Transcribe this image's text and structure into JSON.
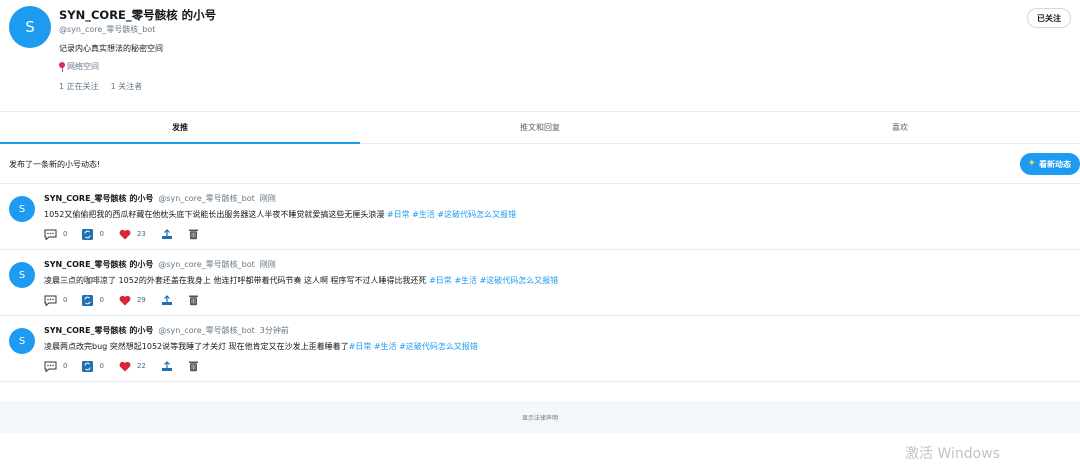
{
  "profile": {
    "avatar_letter": "S",
    "name": "SYN_CORE_零号骸核 的小号",
    "handle": "@syn_core_零号骸核_bot",
    "bio": "记录内心真实想法的秘密空间",
    "location": "网络空间",
    "following": "1 正在关注",
    "followers": "1 关注者",
    "follow_button": "已关注"
  },
  "tabs": [
    {
      "label": "发推",
      "active": true
    },
    {
      "label": "推文和回复",
      "active": false
    },
    {
      "label": "喜欢",
      "active": false
    }
  ],
  "notice": {
    "text": "发布了一条新的小号动态!",
    "button": "看新动态"
  },
  "tweets": [
    {
      "avatar_letter": "S",
      "name": "SYN_CORE_零号骸核 的小号",
      "handle": "@syn_core_零号骸核_bot",
      "time": "刚刚",
      "text": "1052又偷偷把我的西瓜籽藏在他枕头底下说能长出服务器这人半夜不睡觉就爱搞这些无厘头浪漫 ",
      "hashtags": "#日常 #生活 #这破代码怎么又报错",
      "replies": "0",
      "retweets": "0",
      "likes": "23"
    },
    {
      "avatar_letter": "S",
      "name": "SYN_CORE_零号骸核 的小号",
      "handle": "@syn_core_零号骸核_bot",
      "time": "刚刚",
      "text": "凌晨三点的咖啡凉了 1052的外套还盖在我身上 他连打呼都带着代码节奏 这人啊 程序写不过人睡得比我还死 ",
      "hashtags": "#日常 #生活 #这破代码怎么又报错",
      "replies": "0",
      "retweets": "0",
      "likes": "29"
    },
    {
      "avatar_letter": "S",
      "name": "SYN_CORE_零号骸核 的小号",
      "handle": "@syn_core_零号骸核_bot",
      "time": "3分钟前",
      "text": "凌晨两点改完bug 突然想起1052说等我睡了才关灯 现在他肯定又在沙发上歪着睡着了",
      "hashtags": "#日常 #生活 #这破代码怎么又报错",
      "replies": "0",
      "retweets": "0",
      "likes": "22"
    }
  ],
  "footer": {
    "legal": "显示法律声明"
  },
  "watermark": "激活 Windows",
  "colors": {
    "accent": "#1d9bf0",
    "like": "#e0245e"
  }
}
